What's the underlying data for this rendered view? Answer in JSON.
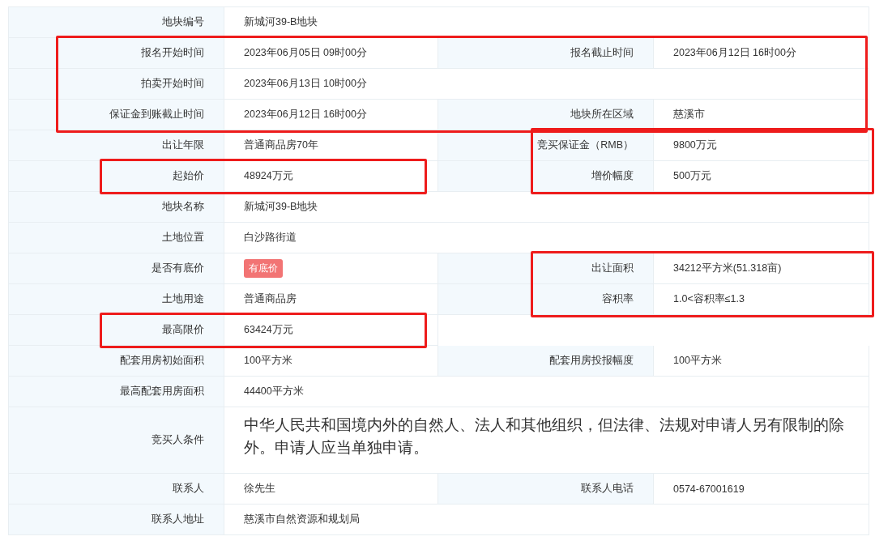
{
  "rows": [
    {
      "kind": "single",
      "label": "地块编号",
      "value": "新城河39-B地块",
      "marked": false,
      "marked_left": false,
      "marked_right": false
    },
    {
      "kind": "pair",
      "label": "报名开始时间",
      "value": "2023年06月05日 09时00分",
      "label2": "报名截止时间",
      "value2": "2023年06月12日 16时00分",
      "marked": true,
      "marked_left": false,
      "marked_right": false
    },
    {
      "kind": "single",
      "label": "拍卖开始时间",
      "value": "2023年06月13日 10时00分",
      "marked": true,
      "marked_left": false,
      "marked_right": false
    },
    {
      "kind": "pair",
      "label": "保证金到账截止时间",
      "value": "2023年06月12日 16时00分",
      "label2": "地块所在区域",
      "value2": "慈溪市",
      "marked": true,
      "marked_left": false,
      "marked_right": false
    },
    {
      "kind": "pair",
      "label": "出让年限",
      "value": "普通商品房70年",
      "label2": "竞买保证金（RMB）",
      "value2": "9800万元",
      "marked": false,
      "marked_left": false,
      "marked_right": true
    },
    {
      "kind": "pair",
      "label": "起始价",
      "value": "48924万元",
      "label2": "增价幅度",
      "value2": "500万元",
      "marked": false,
      "marked_left": true,
      "marked_right": true
    },
    {
      "kind": "single",
      "label": "地块名称",
      "value": "新城河39-B地块",
      "marked": false,
      "marked_left": false,
      "marked_right": false
    },
    {
      "kind": "single",
      "label": "土地位置",
      "value": "白沙路街道",
      "marked": false,
      "marked_left": false,
      "marked_right": false
    },
    {
      "kind": "tagged",
      "label": "是否有底价",
      "value": "有底价",
      "label2": "出让面积",
      "value2": "34212平方米(51.318亩)",
      "marked": false,
      "marked_left": false,
      "marked_right": true
    },
    {
      "kind": "pair",
      "label": "土地用途",
      "value": "普通商品房",
      "label2": "容积率",
      "value2": "1.0<容积率≤1.3",
      "marked": false,
      "marked_left": false,
      "marked_right": true
    },
    {
      "kind": "half",
      "label": "最高限价",
      "value": "63424万元",
      "marked": false,
      "marked_left": true,
      "marked_right": false
    },
    {
      "kind": "pair",
      "label": "配套用房初始面积",
      "value": "100平方米",
      "label2": "配套用房投报幅度",
      "value2": "100平方米",
      "marked": false,
      "marked_left": false,
      "marked_right": false
    },
    {
      "kind": "single",
      "label": "最高配套用房面积",
      "value": "44400平方米",
      "marked": false,
      "marked_left": false,
      "marked_right": false
    },
    {
      "kind": "note",
      "label": "竞买人条件",
      "value": "中华人民共和国境内外的自然人、法人和其他组织，但法律、法规对申请人另有限制的除外。申请人应当单独申请。",
      "marked": false,
      "marked_left": false,
      "marked_right": false
    },
    {
      "kind": "pair",
      "label": "联系人",
      "value": "徐先生",
      "label2": "联系人电话",
      "value2": "0574-67001619",
      "marked": false,
      "marked_left": false,
      "marked_right": false
    },
    {
      "kind": "single",
      "label": "联系人地址",
      "value": "慈溪市自然资源和规划局",
      "marked": false,
      "marked_left": false,
      "marked_right": false
    }
  ]
}
